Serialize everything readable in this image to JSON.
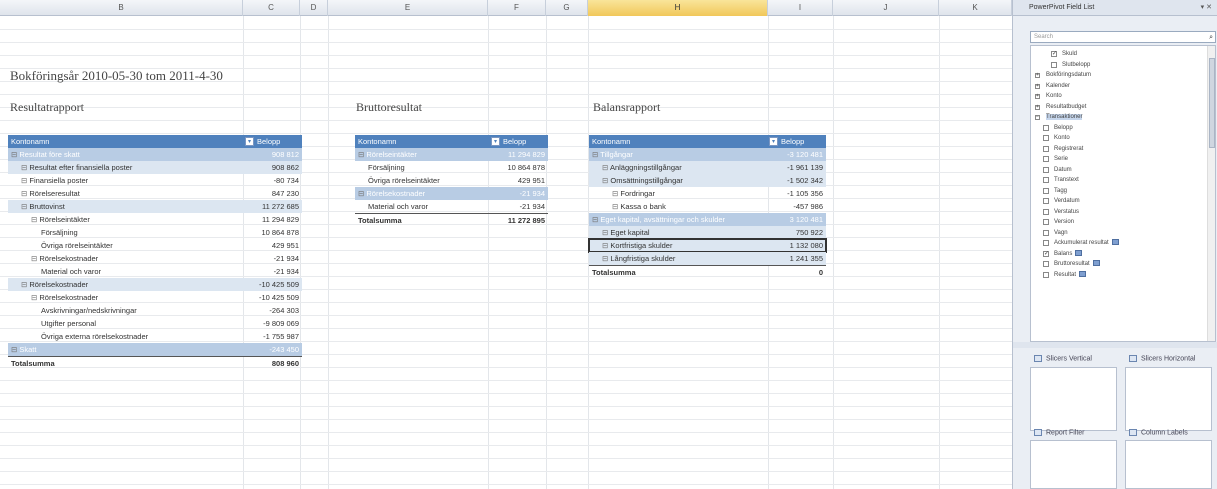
{
  "sheet": {
    "columns": [
      "B",
      "C",
      "D",
      "E",
      "F",
      "G",
      "H",
      "I",
      "J",
      "K"
    ],
    "selected_column": "H",
    "heading": "Bokföringsår 2010-05-30 tom 2011-4-30"
  },
  "resultat": {
    "title": "Resultatrapport",
    "header_label": "Kontonamn",
    "header_value": "Belopp",
    "rows": [
      {
        "label": "Resultat före skatt",
        "value": "908 812",
        "style": "sub",
        "indent": 0
      },
      {
        "label": "Resultat efter finansiella poster",
        "value": "908 862",
        "style": "sub2",
        "indent": 1
      },
      {
        "label": "Finansiella poster",
        "value": "-80 734",
        "style": "",
        "indent": 1
      },
      {
        "label": "Rörelseresultat",
        "value": "847 230",
        "style": "",
        "indent": 1
      },
      {
        "label": "Bruttovinst",
        "value": "11 272 685",
        "style": "sub2",
        "indent": 1
      },
      {
        "label": "Rörelseintäkter",
        "value": "11 294 829",
        "style": "",
        "indent": 2
      },
      {
        "label": "Försäljning",
        "value": "10 864 878",
        "style": "",
        "indent": 3
      },
      {
        "label": "Övriga rörelseintäkter",
        "value": "429 951",
        "style": "",
        "indent": 3
      },
      {
        "label": "Rörelsekostnader",
        "value": "-21 934",
        "style": "",
        "indent": 2
      },
      {
        "label": "Material och varor",
        "value": "-21 934",
        "style": "",
        "indent": 3
      },
      {
        "label": "Rörelsekostnader",
        "value": "-10 425 509",
        "style": "sub2",
        "indent": 1
      },
      {
        "label": "Rörelsekostnader",
        "value": "-10 425 509",
        "style": "",
        "indent": 2
      },
      {
        "label": "Avskrivningar/nedskrivningar",
        "value": "-264 303",
        "style": "",
        "indent": 3
      },
      {
        "label": "Utgifter personal",
        "value": "-9 809 069",
        "style": "",
        "indent": 3
      },
      {
        "label": "Övriga externa rörelsekostnader",
        "value": "-1 755 987",
        "style": "",
        "indent": 3
      },
      {
        "label": "Skatt",
        "value": "-243 450",
        "style": "sub",
        "indent": 0
      }
    ],
    "total_label": "Totalsumma",
    "total_value": "808 960"
  },
  "brutto": {
    "title": "Bruttoresultat",
    "header_label": "Kontonamn",
    "header_value": "Belopp",
    "rows": [
      {
        "label": "Rörelseintäkter",
        "value": "11 294 829",
        "style": "sub",
        "indent": 0
      },
      {
        "label": "Försäljning",
        "value": "10 864 878",
        "style": "",
        "indent": 1
      },
      {
        "label": "Övriga rörelseintäkter",
        "value": "429 951",
        "style": "",
        "indent": 1
      },
      {
        "label": "Rörelsekostnader",
        "value": "-21 934",
        "style": "sub",
        "indent": 0
      },
      {
        "label": "Material och varor",
        "value": "-21 934",
        "style": "",
        "indent": 1
      }
    ],
    "total_label": "Totalsumma",
    "total_value": "11 272 895"
  },
  "balans": {
    "title": "Balansrapport",
    "header_label": "Kontonamn",
    "header_value": "Belopp",
    "rows": [
      {
        "label": "Tillgångar",
        "value": "-3 120 481",
        "style": "sub",
        "indent": 0
      },
      {
        "label": "Anläggningstillgångar",
        "value": "-1 961 139",
        "style": "sub2",
        "indent": 1
      },
      {
        "label": "Omsättningstillgångar",
        "value": "-1 502 342",
        "style": "sub2",
        "indent": 1
      },
      {
        "label": "Fordringar",
        "value": "-1 105 356",
        "style": "",
        "indent": 2
      },
      {
        "label": "Kassa o bank",
        "value": "-457 986",
        "style": "",
        "indent": 2
      },
      {
        "label": "Eget kapital, avsättningar och skulder",
        "value": "3 120 481",
        "style": "sub",
        "indent": 0
      },
      {
        "label": "Eget kapital",
        "value": "750 922",
        "style": "sub2",
        "indent": 1
      },
      {
        "label": "Kortfristiga skulder",
        "value": "1 132 080",
        "style": "sub2 selbox",
        "indent": 1
      },
      {
        "label": "Långfristiga skulder",
        "value": "1 241 355",
        "style": "sub2",
        "indent": 1
      }
    ],
    "total_label": "Totalsumma",
    "total_value": "0"
  },
  "pane": {
    "title": "PowerPivot Field List",
    "search_placeholder": "Search",
    "fields": [
      {
        "label": "Skuld",
        "type": "check",
        "checked": true,
        "level": 2
      },
      {
        "label": "Slutbelopp",
        "type": "check",
        "checked": false,
        "level": 2
      },
      {
        "label": "Bokföringsdatum",
        "type": "table",
        "level": 0
      },
      {
        "label": "Kalender",
        "type": "table",
        "level": 0
      },
      {
        "label": "Konto",
        "type": "table",
        "level": 0
      },
      {
        "label": "Resultatbudget",
        "type": "table",
        "level": 0
      },
      {
        "label": "Transaktioner",
        "type": "table-open",
        "level": 0
      },
      {
        "label": "Belopp",
        "type": "field",
        "level": 1
      },
      {
        "label": "Konto",
        "type": "field",
        "level": 1
      },
      {
        "label": "Registrerat",
        "type": "field",
        "level": 1
      },
      {
        "label": "Serie",
        "type": "field",
        "level": 1
      },
      {
        "label": "Datum",
        "type": "field",
        "level": 1
      },
      {
        "label": "Transtext",
        "type": "field",
        "level": 1
      },
      {
        "label": "Tagg",
        "type": "field",
        "level": 1
      },
      {
        "label": "Verdatum",
        "type": "field",
        "level": 1
      },
      {
        "label": "Verstatus",
        "type": "field",
        "level": 1
      },
      {
        "label": "Version",
        "type": "field",
        "level": 1
      },
      {
        "label": "Vagn",
        "type": "field",
        "level": 1
      },
      {
        "label": "Ackumulerat resultat",
        "type": "measure",
        "level": 1
      },
      {
        "label": "Balans",
        "type": "measure-check",
        "level": 1
      },
      {
        "label": "Bruttoresultat",
        "type": "measure",
        "level": 1
      },
      {
        "label": "Resultat",
        "type": "measure",
        "level": 1
      }
    ],
    "areas": {
      "vertical_slicers": "Slicers Vertical",
      "horizontal_slicers": "Slicers Horizontal",
      "report_filter": "Report Filter",
      "column_labels": "Column Labels"
    }
  }
}
